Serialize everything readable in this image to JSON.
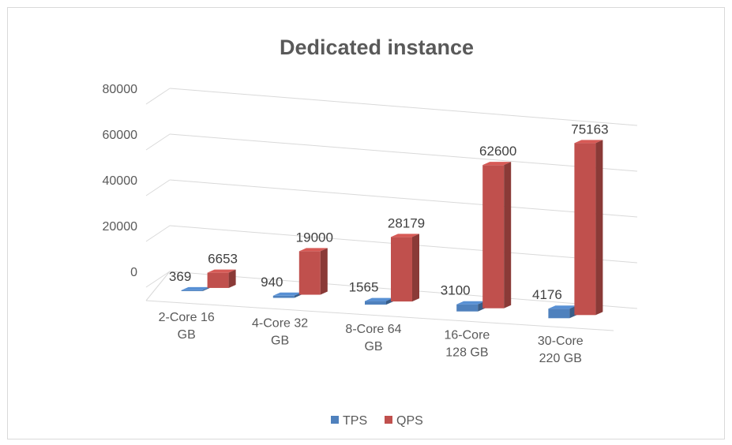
{
  "chart_data": {
    "type": "bar",
    "title": "Dedicated instance",
    "categories": [
      "2-Core 16 GB",
      "4-Core 32 GB",
      "8-Core 64 GB",
      "16-Core 128 GB",
      "30-Core 220 GB"
    ],
    "category_lines": [
      [
        "2-Core 16",
        "GB"
      ],
      [
        "4-Core 32",
        "GB"
      ],
      [
        "8-Core 64",
        "GB"
      ],
      [
        "16-Core",
        "128 GB"
      ],
      [
        "30-Core",
        "220 GB"
      ]
    ],
    "series": [
      {
        "name": "TPS",
        "values": [
          369,
          940,
          1565,
          3100,
          4176
        ],
        "color": "#4f81bd"
      },
      {
        "name": "QPS",
        "values": [
          6653,
          19000,
          28179,
          62600,
          75163
        ],
        "color": "#c0504d"
      }
    ],
    "ylim": [
      0,
      80000
    ],
    "yticks": [
      "0",
      "20000",
      "40000",
      "60000",
      "80000"
    ],
    "grid": true,
    "legend_position": "bottom",
    "style": "3d-clustered-column"
  }
}
